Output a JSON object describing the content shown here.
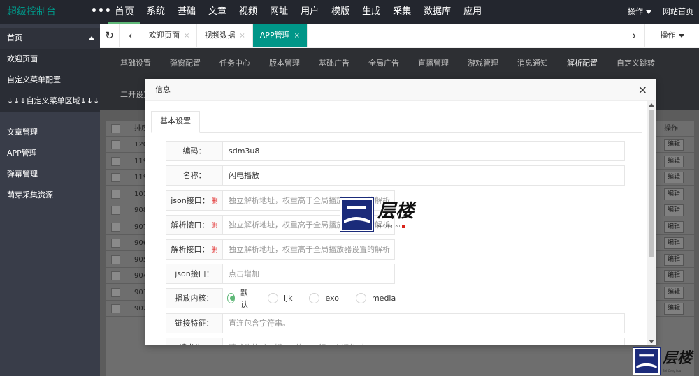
{
  "topbar": {
    "brand": "超级控制台",
    "more": "•••",
    "nav": [
      "首页",
      "系统",
      "基础",
      "文章",
      "视频",
      "网址",
      "用户",
      "模版",
      "生成",
      "采集",
      "数据库",
      "应用"
    ],
    "active_nav": 0,
    "operations": "操作",
    "site_home": "网站首页"
  },
  "sidebar": {
    "home": "首页",
    "sub_items": [
      "欢迎页面",
      "自定义菜单配置",
      "↓↓↓自定义菜单区域↓↓↓"
    ],
    "items": [
      "文章管理",
      "APP管理",
      "弹幕管理",
      "萌芽采集资源"
    ]
  },
  "tabbar": {
    "tabs": [
      {
        "label": "欢迎页面",
        "close": "×"
      },
      {
        "label": "视频数据",
        "close": "×"
      },
      {
        "label": "APP管理",
        "close": "×"
      }
    ],
    "active_tab": 2,
    "operations": "操作"
  },
  "subtabs": {
    "items": [
      "基础设置",
      "弹窗配置",
      "任务中心",
      "版本管理",
      "基础广告",
      "全局广告",
      "直播管理",
      "游戏管理",
      "消息通知",
      "解析配置",
      "自定义跳转"
    ],
    "active": 9,
    "row2": "二开设置"
  },
  "table": {
    "head": {
      "id": "排序",
      "ops": "操作"
    },
    "ids": [
      "120",
      "119",
      "119",
      "101",
      "908",
      "907",
      "906",
      "905",
      "904",
      "903",
      "902"
    ],
    "edit_label": "编辑"
  },
  "modal": {
    "title": "信息",
    "close": "×",
    "form_tab": "基本设置",
    "fields": [
      {
        "label": "编码：",
        "value": "sdm3u8",
        "placeholder": false,
        "del": ""
      },
      {
        "label": "名称：",
        "value": "闪电播放",
        "placeholder": false,
        "del": ""
      },
      {
        "label": "json接口：",
        "value": "独立解析地址，权重高于全局播放器设置的解析",
        "placeholder": true,
        "del": "删"
      },
      {
        "label": "解析接口：",
        "value": "独立解析地址，权重高于全局播放器设置的解析",
        "placeholder": true,
        "del": "删"
      },
      {
        "label": "解析接口：",
        "value": "独立解析地址，权重高于全局播放器设置的解析",
        "placeholder": true,
        "del": "删"
      },
      {
        "label": "json接口：",
        "value": "点击增加",
        "placeholder": true,
        "del": ""
      }
    ],
    "kernel": {
      "label": "播放内核：",
      "options": [
        "默认",
        "ijk",
        "exo",
        "media"
      ],
      "selected": 0
    },
    "link_feature": {
      "label": "链接特征：",
      "placeholder": "直连包含字符串。"
    },
    "request_header": {
      "label": "请求头：",
      "placeholder": "请求头格式：键=>值，一行一个键值对"
    }
  },
  "watermark": {
    "text": "层楼",
    "sub": "Bei Ceng Lou"
  },
  "colors": {
    "accent": "#009688",
    "green": "#5fb878",
    "topbar": "#23262e",
    "sidebar": "#393d49",
    "delete": "#e02020",
    "logo_blue": "#1b2b7a"
  }
}
